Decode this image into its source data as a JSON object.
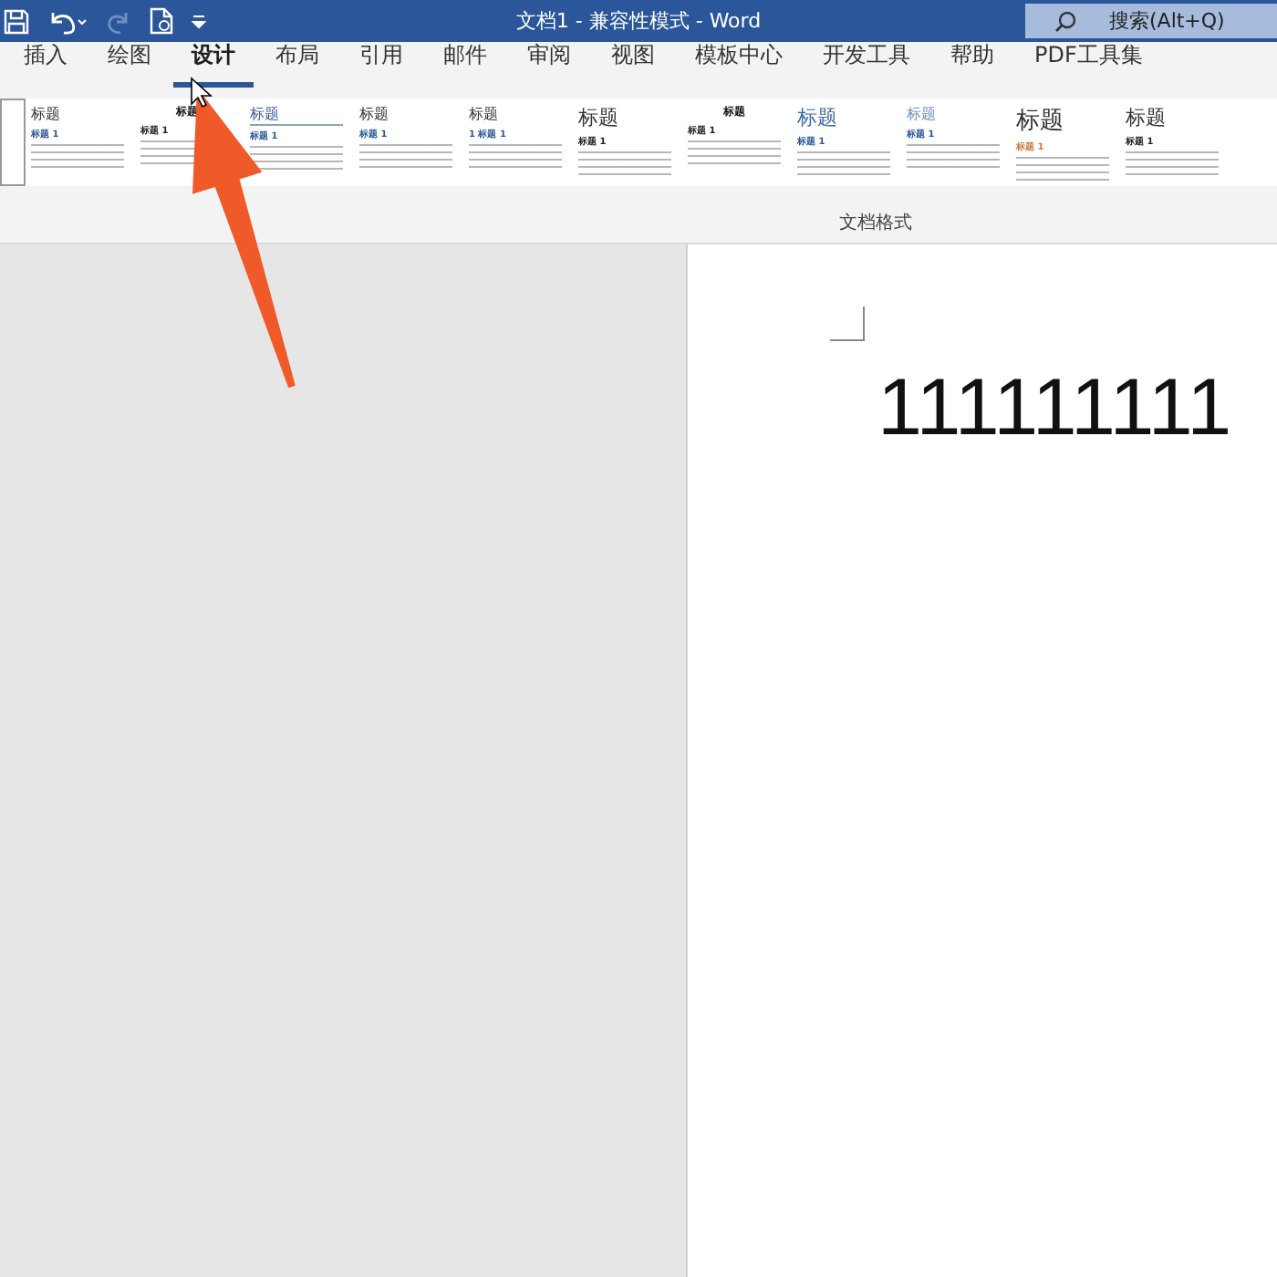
{
  "title_bar": {
    "title": "文档1 - 兼容性模式 - Word",
    "search": {
      "placeholder": "搜索(Alt+Q)"
    },
    "quick_access": [
      {
        "kind": "save",
        "disabled": false
      },
      {
        "kind": "undo",
        "disabled": false
      },
      {
        "kind": "redo",
        "disabled": true
      },
      {
        "kind": "document",
        "disabled": false
      },
      {
        "kind": "customize",
        "disabled": false
      }
    ]
  },
  "tabs": [
    {
      "label": "插入",
      "selected": false
    },
    {
      "label": "绘图",
      "selected": false
    },
    {
      "label": "设计",
      "selected": true
    },
    {
      "label": "布局",
      "selected": false
    },
    {
      "label": "引用",
      "selected": false
    },
    {
      "label": "邮件",
      "selected": false
    },
    {
      "label": "审阅",
      "selected": false
    },
    {
      "label": "视图",
      "selected": false
    },
    {
      "label": "模板中心",
      "selected": false
    },
    {
      "label": "开发工具",
      "selected": false
    },
    {
      "label": "帮助",
      "selected": false
    },
    {
      "label": "PDF工具集",
      "selected": false
    }
  ],
  "style_gallery": {
    "label": "文档格式",
    "items": [
      {
        "kind": "plain",
        "title": "标题",
        "heading": "标题 1"
      },
      {
        "kind": "centered",
        "title": "标题",
        "heading": "标题 1"
      },
      {
        "kind": "underlined",
        "title": "标题",
        "heading": "标题 1"
      },
      {
        "kind": "plain",
        "title": "标题",
        "heading": "标题 1"
      },
      {
        "kind": "numbered",
        "title": "标题",
        "heading": "1 标题 1"
      },
      {
        "kind": "large",
        "title": "标题",
        "heading": "标题 1"
      },
      {
        "kind": "centered",
        "title": "标题",
        "heading": "标题 1"
      },
      {
        "kind": "blue",
        "title": "标题",
        "heading": "标题 1"
      },
      {
        "kind": "small-blue",
        "title": "标题",
        "heading": "标题 1"
      },
      {
        "kind": "accent",
        "title": "标题",
        "heading": "标题 1"
      },
      {
        "kind": "large",
        "title": "标题",
        "heading": "标题 1"
      }
    ]
  },
  "document": {
    "text": "111111111"
  }
}
